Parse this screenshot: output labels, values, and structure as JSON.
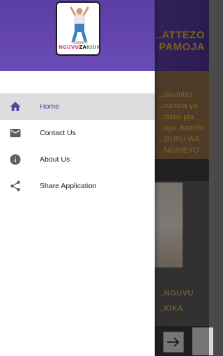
{
  "background": {
    "banner_text": "...ATTEZO\nPAMOJA",
    "card_text": "...ekumbia\n...namna ya\n...lakini pia\n...ayo. baadhi\n...GUFU WA\n...NGINEYO",
    "photo_text": "...NGUVU\n...KIKA",
    "next_icon": "arrow-right-icon"
  },
  "drawer": {
    "logo": {
      "text_start": "NGUVU",
      "text_mid": "ZA",
      "text_end": "KIUME"
    },
    "items": [
      {
        "label": "Home",
        "icon": "home-icon",
        "active": true
      },
      {
        "label": "Contact Us",
        "icon": "mail-icon",
        "active": false
      },
      {
        "label": "About Us",
        "icon": "info-icon",
        "active": false
      },
      {
        "label": "Share Application",
        "icon": "share-icon",
        "active": false
      }
    ]
  },
  "colors": {
    "header": "#5b3ea3",
    "active_text": "#5b3ea3",
    "active_bg": "#dcdcdc"
  }
}
